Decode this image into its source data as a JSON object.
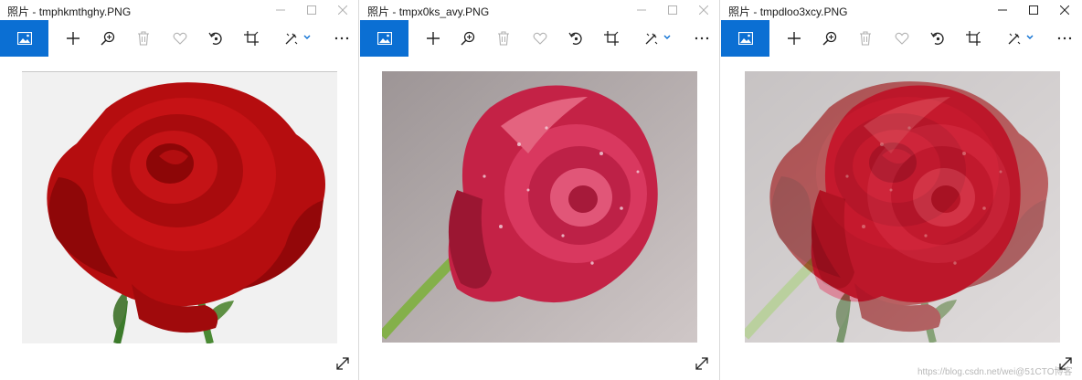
{
  "windows": [
    {
      "app": "照片",
      "filename": "tmphkmthghy.PNG",
      "image_desc": "red-rose-white-bg"
    },
    {
      "app": "照片",
      "filename": "tmpx0ks_avy.PNG",
      "image_desc": "pink-rose-dewdrops"
    },
    {
      "app": "照片",
      "filename": "tmpdloo3xcy.PNG",
      "image_desc": "blended-roses"
    }
  ],
  "watermark": "https://blog.csdn.net/wei@51CTO博客",
  "colors": {
    "accent": "#0b6fd3",
    "icon": "#222222",
    "disabled_icon": "#9a9a9a"
  }
}
